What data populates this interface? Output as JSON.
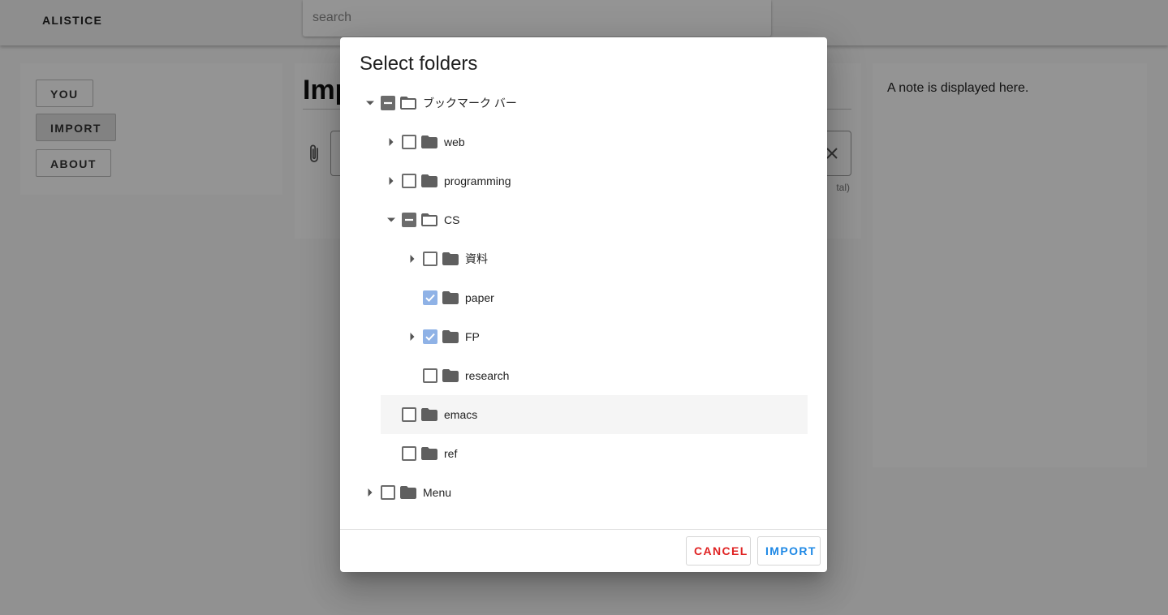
{
  "app": {
    "brand": "ALISTICE",
    "search_placeholder": "search"
  },
  "nav": {
    "you": "YOU",
    "import": "IMPORT",
    "about": "ABOUT"
  },
  "main": {
    "title_visible": "Imp",
    "hint_visible": "tal)"
  },
  "note": {
    "text": "A note is displayed here."
  },
  "dialog": {
    "title": "Select folders",
    "tree": [
      {
        "label": "ブックマーク バー",
        "level": 0,
        "expander": "expanded",
        "state": "indeterminate",
        "folder": "open"
      },
      {
        "label": "web",
        "level": 1,
        "expander": "collapsed",
        "state": "unchecked",
        "folder": "closed"
      },
      {
        "label": "programming",
        "level": 1,
        "expander": "collapsed",
        "state": "unchecked",
        "folder": "closed"
      },
      {
        "label": "CS",
        "level": 1,
        "expander": "expanded",
        "state": "indeterminate",
        "folder": "open"
      },
      {
        "label": "資料",
        "level": 2,
        "expander": "collapsed",
        "state": "unchecked",
        "folder": "closed"
      },
      {
        "label": "paper",
        "level": 2,
        "expander": "none",
        "state": "checked",
        "folder": "closed"
      },
      {
        "label": "FP",
        "level": 2,
        "expander": "collapsed",
        "state": "checked",
        "folder": "closed"
      },
      {
        "label": "research",
        "level": 2,
        "expander": "none",
        "state": "unchecked",
        "folder": "closed"
      },
      {
        "label": "emacs",
        "level": 1,
        "expander": "none",
        "state": "unchecked",
        "folder": "closed",
        "hovered": true
      },
      {
        "label": "ref",
        "level": 1,
        "expander": "none",
        "state": "unchecked",
        "folder": "closed"
      },
      {
        "label": "Menu",
        "level": 0,
        "expander": "collapsed",
        "state": "unchecked",
        "folder": "closed"
      }
    ],
    "cancel_label": "CANCEL",
    "import_label": "IMPORT"
  },
  "colors": {
    "cancel": "#e02323",
    "import": "#1e88e5",
    "checked": "#8fb2e6",
    "folder": "#5f5f5f"
  }
}
